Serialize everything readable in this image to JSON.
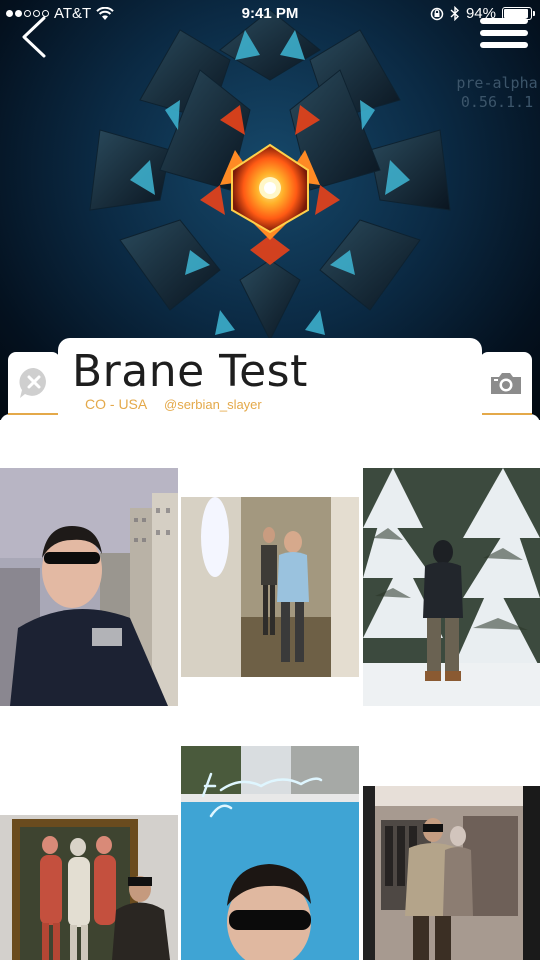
{
  "status_bar": {
    "carrier": "AT&T",
    "time": "9:41 PM",
    "battery_percent": "94%",
    "battery_level": 0.94
  },
  "nav": {
    "back_icon": "chevron-left-icon",
    "menu_icon": "hamburger-menu-icon"
  },
  "banner": {
    "version_line1": "pre-alpha",
    "version_line2": "0.56.1.1"
  },
  "profile": {
    "name": "Brane Test",
    "location": "CO - USA",
    "handle": "@serbian_slayer"
  },
  "actions": {
    "left_icon": "close-circle-icon",
    "right_icon": "camera-icon"
  },
  "photos": [
    {
      "name": "photo-city-selfie"
    },
    {
      "name": "photo-mirror-selfie"
    },
    {
      "name": "photo-snow-trees"
    },
    {
      "name": "photo-museum-painting"
    },
    {
      "name": "photo-hamptons-pool"
    },
    {
      "name": "photo-store-mirror"
    }
  ],
  "colors": {
    "accent": "#e4a94a",
    "banner_dark": "#04111f",
    "banner_blue": "#16486a"
  }
}
